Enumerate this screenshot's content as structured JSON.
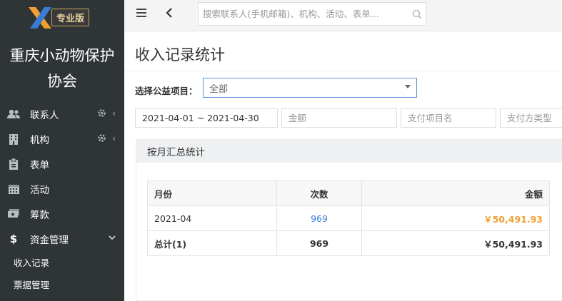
{
  "brand": {
    "badge": "专业版"
  },
  "org": {
    "name": "重庆小动物保护协会"
  },
  "nav": {
    "items": [
      {
        "label": "联系人",
        "icon": "contacts-icon"
      },
      {
        "label": "机构",
        "icon": "building-icon"
      },
      {
        "label": "表单",
        "icon": "clipboard-icon"
      },
      {
        "label": "活动",
        "icon": "calendar-icon"
      },
      {
        "label": "筹款",
        "icon": "money-icon"
      },
      {
        "label": "资金管理",
        "icon": "dollar-icon"
      }
    ],
    "sub_items": [
      {
        "label": "收入记录"
      },
      {
        "label": "票据管理"
      }
    ]
  },
  "topbar": {
    "search_placeholder": "搜索联系人(手机邮箱)、机构、活动、表单..."
  },
  "page": {
    "title": "收入记录统计"
  },
  "filters": {
    "project_label": "选择公益项目：",
    "project_value": "全部",
    "date_range": "2021-04-01 ~ 2021-04-30",
    "amount_placeholder": "金额",
    "pay_item_placeholder": "支付项目名",
    "pay_type_placeholder": "支付方类型"
  },
  "panel": {
    "title": "按月汇总统计"
  },
  "table": {
    "headers": {
      "month": "月份",
      "count": "次数",
      "amount": "金额"
    },
    "rows": [
      {
        "month": "2021-04",
        "count": "969",
        "amount": "￥50,491.93"
      }
    ],
    "total": {
      "month": "总计(1)",
      "count": "969",
      "amount": "￥50,491.93"
    }
  },
  "colors": {
    "sidebar_bg": "#2f3437",
    "accent_blue": "#3a7bd5",
    "amount_orange": "#f0a030"
  }
}
